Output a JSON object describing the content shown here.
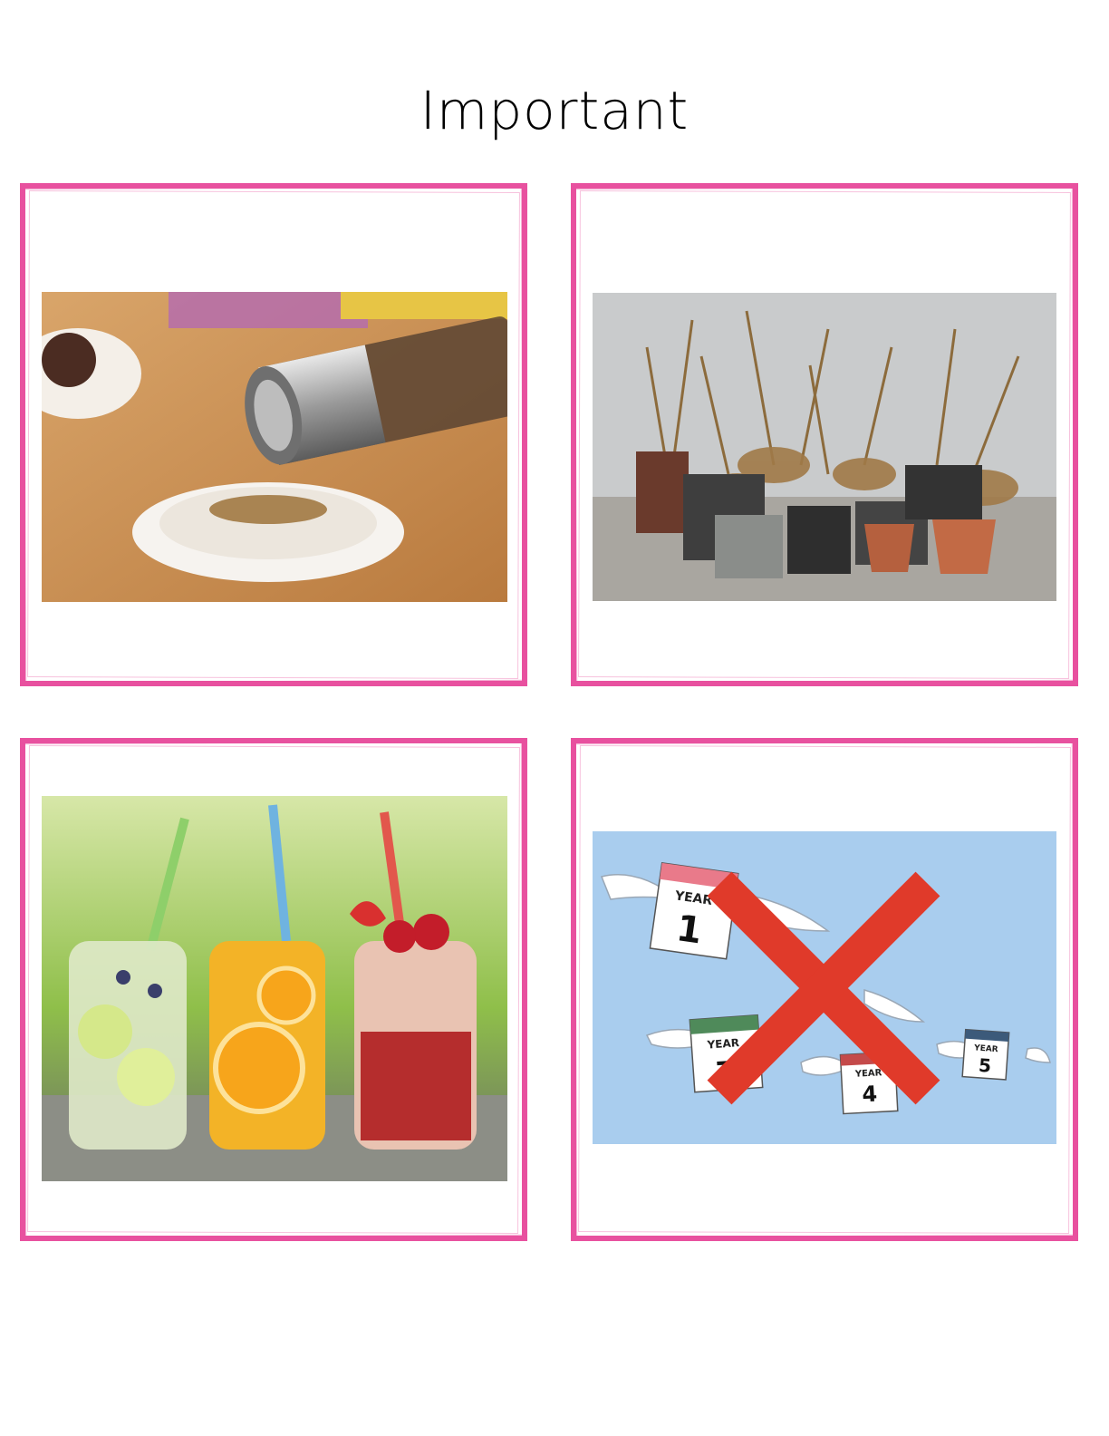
{
  "page": {
    "title": "Important"
  },
  "cards": [
    {
      "id": "pepper",
      "icon": "pepper-grinder-photo"
    },
    {
      "id": "plants",
      "icon": "dead-potted-plants-photo"
    },
    {
      "id": "drinks",
      "icon": "fruit-drinks-jars-photo"
    },
    {
      "id": "years",
      "icon": "flying-calendar-years-crossed-out",
      "calendar_labels": [
        "YEAR",
        "YEAR",
        "YEAR",
        "YEAR"
      ],
      "calendar_numbers": [
        "1",
        "7",
        "4",
        "5"
      ]
    }
  ],
  "colors": {
    "frame": "#e8519f",
    "cross": "#e03a2a",
    "sky": "#a9cdee"
  }
}
